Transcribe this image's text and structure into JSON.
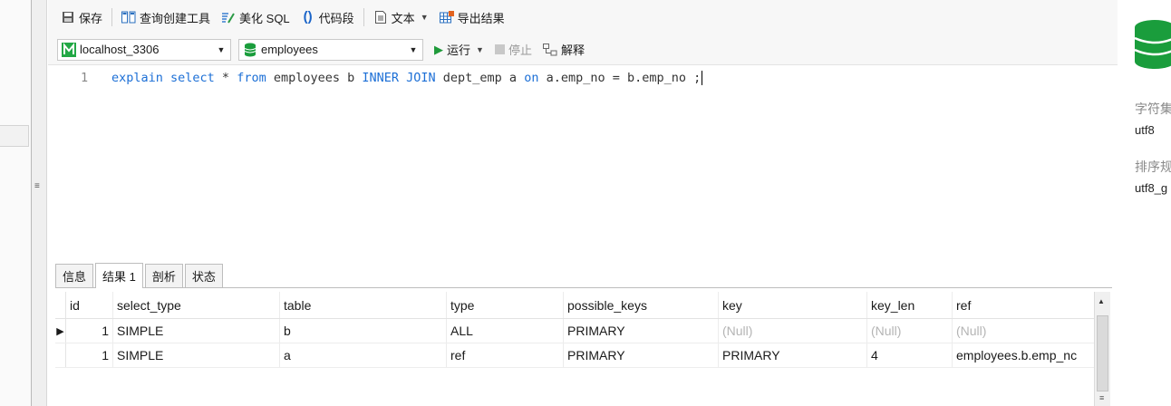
{
  "toolbar": {
    "save": "保存",
    "query_builder": "查询创建工具",
    "beautify": "美化 SQL",
    "snippet": "代码段",
    "text": "文本",
    "export": "导出结果"
  },
  "connection": {
    "server": "localhost_3306",
    "database": "employees",
    "run": "运行",
    "stop": "停止",
    "explain": "解释"
  },
  "editor": {
    "line_number": "1",
    "code_tokens": [
      {
        "t": "explain select",
        "kw": true
      },
      {
        "t": " * ",
        "kw": false
      },
      {
        "t": "from",
        "kw": true
      },
      {
        "t": " employees b ",
        "kw": false
      },
      {
        "t": "INNER JOIN",
        "kw": true
      },
      {
        "t": " dept_emp a ",
        "kw": false
      },
      {
        "t": "on",
        "kw": true
      },
      {
        "t": " a.emp_no = b.emp_no ;",
        "kw": false
      }
    ]
  },
  "result_tabs": [
    {
      "label": "信息",
      "active": false
    },
    {
      "label": "结果 1",
      "active": true
    },
    {
      "label": "剖析",
      "active": false
    },
    {
      "label": "状态",
      "active": false
    }
  ],
  "grid": {
    "columns": [
      "id",
      "select_type",
      "table",
      "type",
      "possible_keys",
      "key",
      "key_len",
      "ref"
    ],
    "rows": [
      {
        "id": "1",
        "select_type": "SIMPLE",
        "table": "b",
        "type": "ALL",
        "possible_keys": "PRIMARY",
        "key": "(Null)",
        "key_len": "(Null)",
        "ref": "(Null)",
        "current": true
      },
      {
        "id": "1",
        "select_type": "SIMPLE",
        "table": "a",
        "type": "ref",
        "possible_keys": "PRIMARY",
        "key": "PRIMARY",
        "key_len": "4",
        "ref": "employees.b.emp_nc",
        "current": false
      }
    ]
  },
  "info_panel": {
    "charset_label": "字符集",
    "charset_value": "utf8",
    "collation_label": "排序规",
    "collation_value": "utf8_g"
  },
  "colors": {
    "keyword": "#1c6fd6",
    "null_text": "#b4b4b4",
    "db_green": "#1a9d3c",
    "run_green": "#1f9a3a"
  }
}
